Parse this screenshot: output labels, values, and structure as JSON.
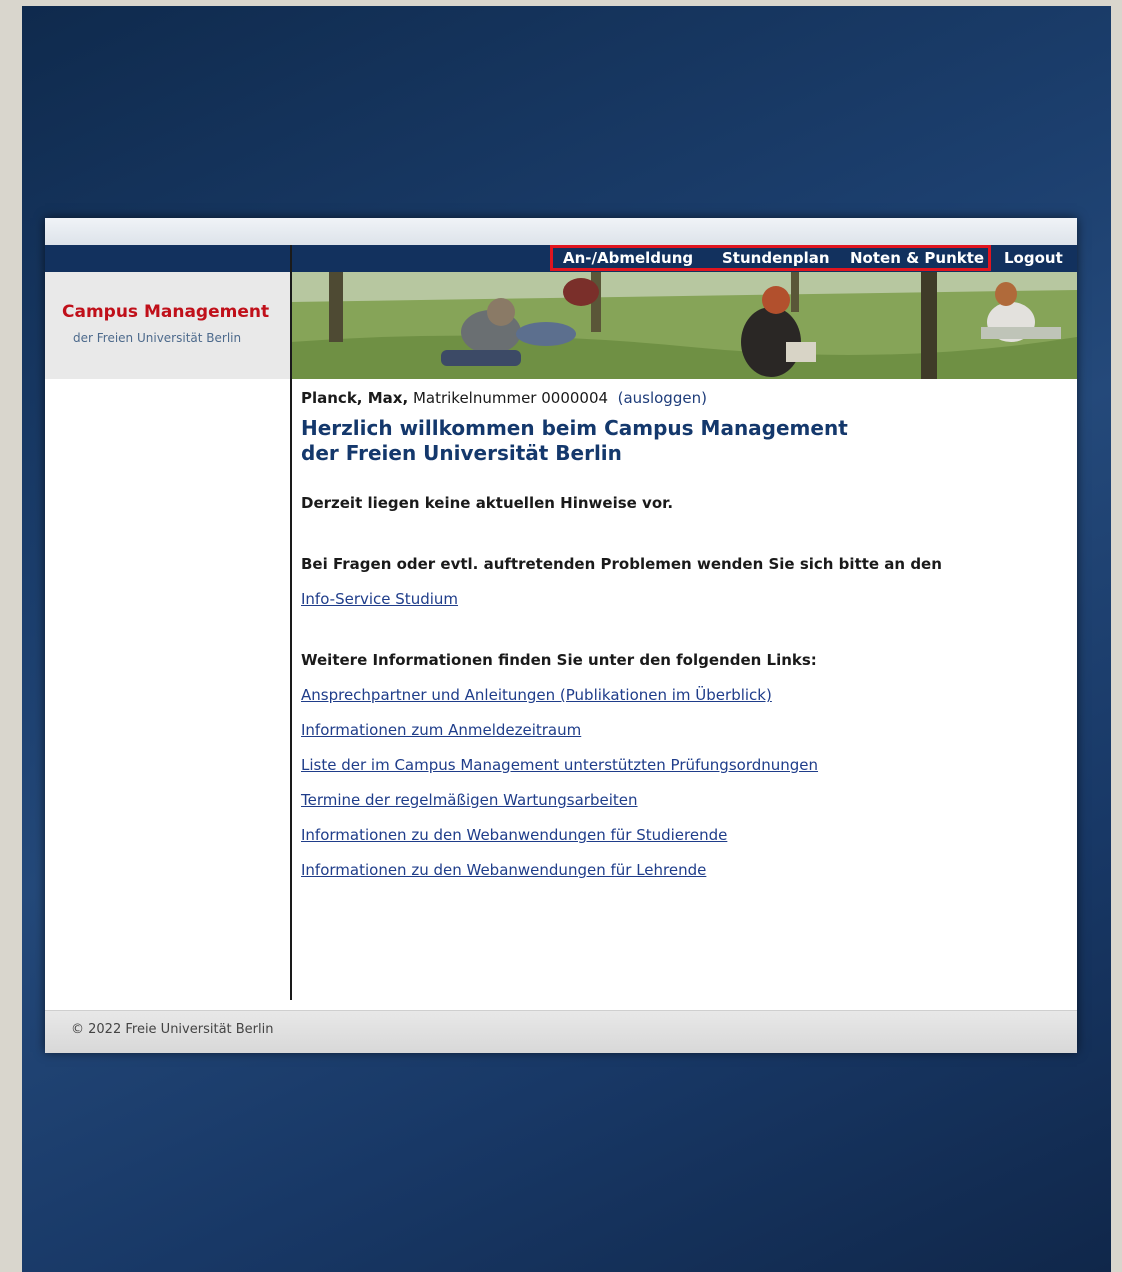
{
  "nav": {
    "items": [
      {
        "label": "An-/Abmeldung"
      },
      {
        "label": "Stundenplan"
      },
      {
        "label": "Noten & Punkte"
      },
      {
        "label": "Logout"
      }
    ]
  },
  "logo": {
    "title": "Campus Management",
    "subtitle": "der Freien Universität Berlin"
  },
  "user": {
    "name": "Planck, Max,",
    "matrikel": "Matrikelnummer 0000004",
    "logout_label": "(ausloggen)"
  },
  "welcome": {
    "line1": "Herzlich willkommen beim Campus Management",
    "line2": "der Freien Universität Berlin"
  },
  "notice": "Derzeit liegen keine aktuellen Hinweise vor.",
  "questions": "Bei Fragen oder evtl. auftretenden Problemen wenden Sie sich bitte an den",
  "info_service_link": "Info-Service Studium",
  "more_info_heading": "Weitere Informationen finden Sie unter den folgenden Links:",
  "links": [
    "Ansprechpartner und Anleitungen (Publikationen im Überblick)",
    "Informationen zum Anmeldezeitraum",
    "Liste der im Campus Management unterstützten Prüfungsordnungen",
    "Termine der regelmäßigen Wartungsarbeiten",
    "Informationen zu den Webanwendungen für Studierende",
    "Informationen zu den Webanwendungen für Lehrende"
  ],
  "footer": "© 2022 Freie Universität Berlin",
  "colors": {
    "navbar": "#12315e",
    "highlight": "#e0151f",
    "brand_red": "#c0101a",
    "heading_blue": "#14386c"
  }
}
